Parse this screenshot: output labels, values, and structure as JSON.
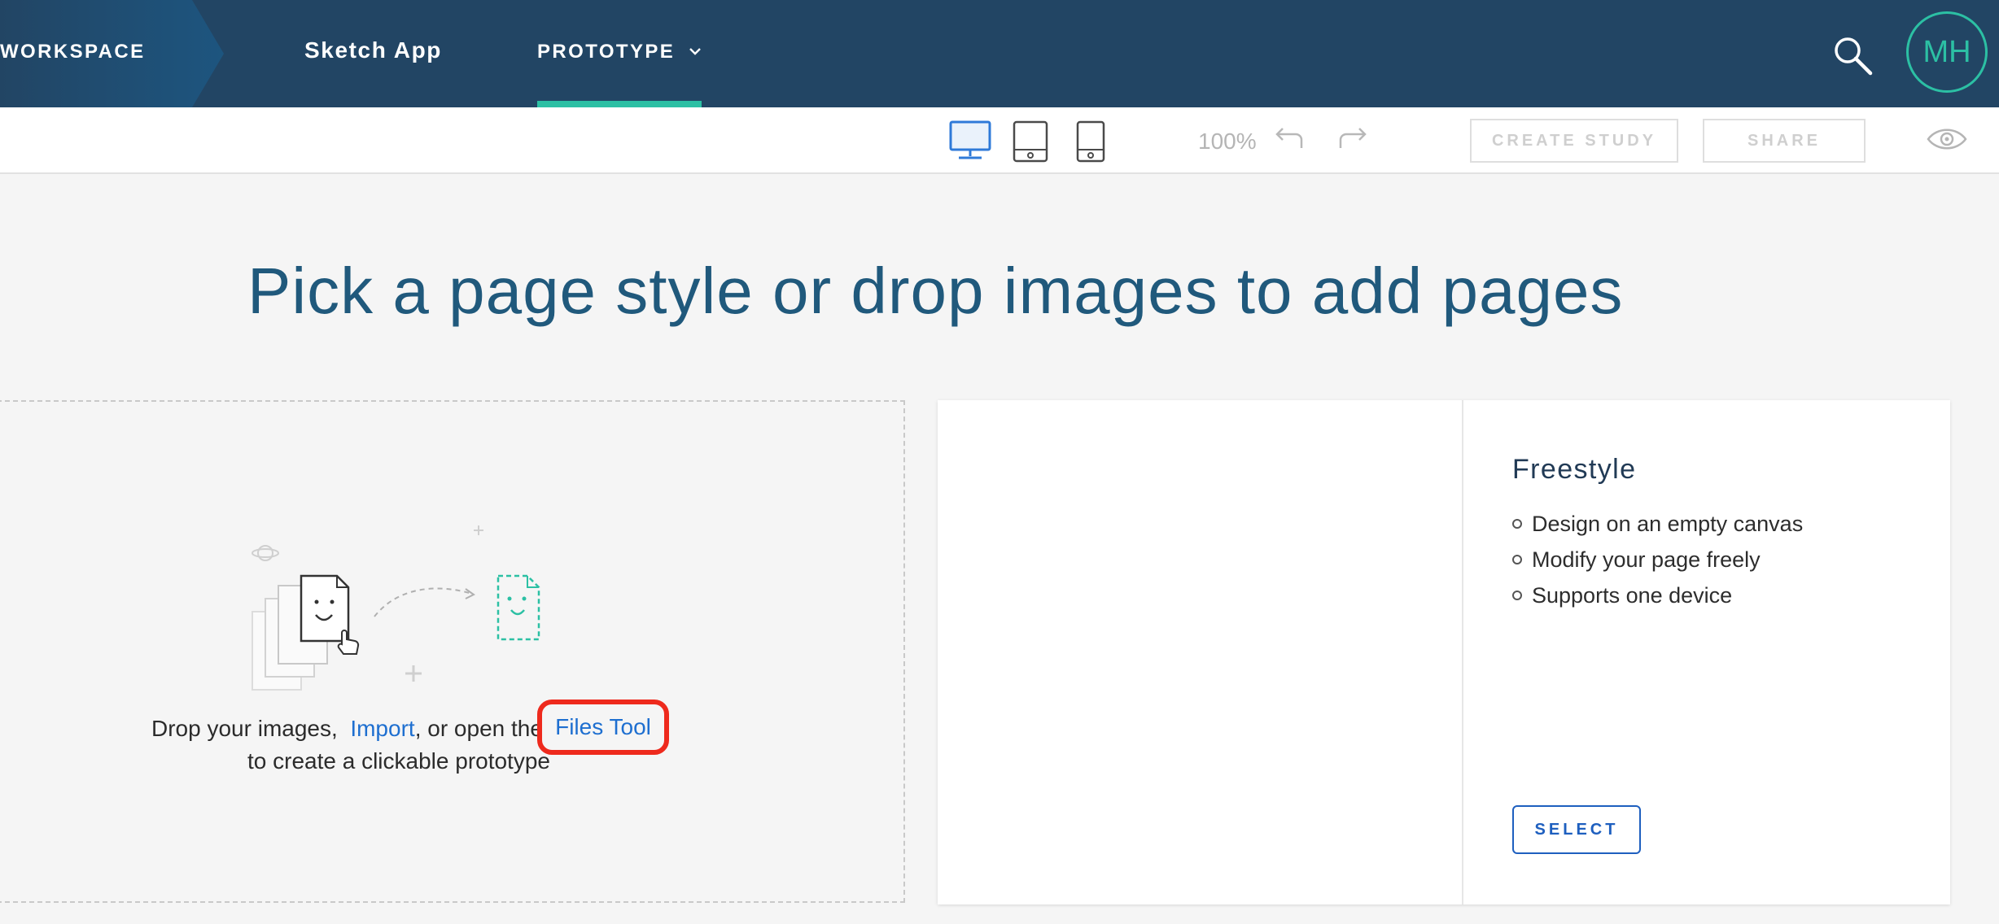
{
  "nav": {
    "workspace_label": "WORKSPACE",
    "project_label": "Sketch App",
    "prototype_label": "PROTOTYPE",
    "avatar_initials": "MH"
  },
  "toolbar": {
    "zoom": "100%",
    "create_study_label": "CREATE STUDY",
    "share_label": "SHARE",
    "active_device": "desktop"
  },
  "main": {
    "headline": "Pick a page style or drop images to add pages",
    "drop": {
      "line1_prefix": "Drop your images,",
      "import_link": "Import",
      "line1_middle": ", or open the",
      "files_tool_link": "Files Tool",
      "line2": "to create a clickable prototype"
    },
    "style_card": {
      "title": "Freestyle",
      "features": [
        "Design on an empty canvas",
        "Modify your page freely",
        "Supports one device"
      ],
      "select_label": "SELECT"
    }
  },
  "colors": {
    "nav_bg": "#224564",
    "accent": "#2cc0a4",
    "link": "#1e6fd0",
    "highlight": "#ee2a1d"
  }
}
